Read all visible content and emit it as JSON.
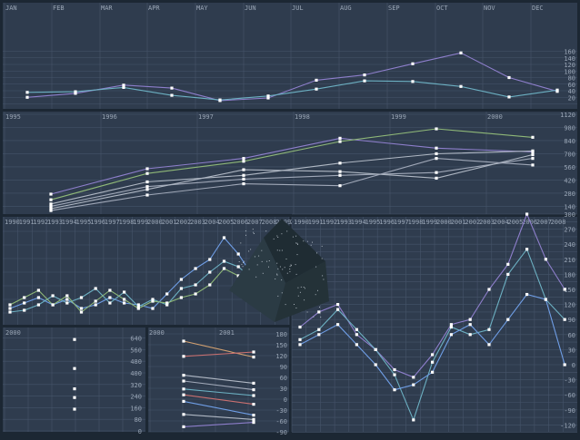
{
  "colors": {
    "background": "#1c2733",
    "panel": "#2f3c4e",
    "grid": "#46546a",
    "text": "#9aa6b6",
    "marker": "#ffffff",
    "purple": "#8e7fcc",
    "teal": "#6cb0c2",
    "blue": "#6f9ee6",
    "green": "#8fb878",
    "gray": "#a0a8b8",
    "silver": "#b0b8c4",
    "red": "#c97070",
    "orange": "#d2a070",
    "cube": "#2c3c44"
  },
  "chart_data": [
    {
      "type": "line",
      "x": [
        "JAN",
        "FEB",
        "MAR",
        "APR",
        "MAY",
        "JUN",
        "JUL",
        "AUG",
        "SEP",
        "OCT",
        "NOV",
        "DEC"
      ],
      "ylim": [
        0,
        170
      ],
      "yticks": [
        "20",
        "40",
        "60",
        "80",
        "100",
        "120",
        "140",
        "160"
      ],
      "series": [
        {
          "color": "purple",
          "values": [
            20,
            32,
            57,
            48,
            10,
            18,
            72,
            88,
            122,
            155,
            80,
            38
          ]
        },
        {
          "color": "teal",
          "values": [
            35,
            37,
            50,
            26,
            12,
            24,
            45,
            70,
            68,
            53,
            21,
            42
          ]
        }
      ],
      "grid": true
    },
    {
      "type": "line",
      "x_labels": [
        "1995",
        "1996",
        "1997",
        "1998",
        "1999",
        "2000"
      ],
      "x": [
        1995.3,
        1996.3,
        1997.3,
        1998.3,
        1999.3,
        2000.3
      ],
      "ylim": [
        70,
        1120
      ],
      "yticks": [
        "140",
        "280",
        "420",
        "560",
        "700",
        "840",
        "980",
        "1120"
      ],
      "series": [
        {
          "color": "purple",
          "values": [
            270,
            540,
            650,
            865,
            760,
            720
          ]
        },
        {
          "color": "green",
          "values": [
            210,
            490,
            620,
            830,
            965,
            875
          ]
        },
        {
          "color": "silver",
          "values": [
            165,
            400,
            470,
            600,
            700,
            730
          ]
        },
        {
          "color": "gray",
          "values": [
            140,
            350,
            430,
            470,
            500,
            650
          ]
        },
        {
          "color": "silver",
          "values": [
            115,
            320,
            530,
            510,
            440,
            690
          ]
        },
        {
          "color": "gray",
          "values": [
            95,
            260,
            380,
            360,
            650,
            580
          ]
        }
      ],
      "grid": true
    },
    {
      "type": "line",
      "x_labels": [
        "1990",
        "1991",
        "1992",
        "1993",
        "1994",
        "1995",
        "1996",
        "1997",
        "1998",
        "1999",
        "2000",
        "2001",
        "2002",
        "2003",
        "2004",
        "2005",
        "2006",
        "2007",
        "2008",
        "2009",
        "2010"
      ],
      "ylim": [
        0,
        300
      ],
      "series": [
        {
          "color": "blue",
          "values": [
            30,
            45,
            60,
            40,
            55,
            30,
            40,
            60,
            45,
            40,
            30,
            70,
            110,
            140,
            165,
            225,
            180,
            120
          ]
        },
        {
          "color": "teal",
          "values": [
            20,
            25,
            40,
            65,
            45,
            60,
            85,
            45,
            75,
            35,
            55,
            40,
            85,
            95,
            130,
            160,
            145,
            110
          ]
        },
        {
          "color": "green",
          "values": [
            40,
            60,
            80,
            40,
            65,
            20,
            50,
            80,
            55,
            30,
            50,
            45,
            60,
            70,
            95,
            140,
            120,
            95
          ]
        }
      ],
      "grid": true
    },
    {
      "type": "line",
      "ylim": [
        -140,
        320
      ],
      "yticks": [
        "-120",
        "-90",
        "-60",
        "-30",
        "0",
        "30",
        "60",
        "90",
        "120",
        "150",
        "180",
        "210",
        "240",
        "270",
        "300"
      ],
      "series": [
        {
          "color": "purple",
          "values": [
            75,
            105,
            120,
            60,
            30,
            -10,
            -25,
            20,
            80,
            90,
            150,
            200,
            300,
            210,
            150
          ]
        },
        {
          "color": "teal",
          "values": [
            50,
            70,
            110,
            70,
            30,
            -20,
            -110,
            5,
            75,
            60,
            70,
            180,
            230,
            130,
            90
          ]
        },
        {
          "color": "blue",
          "values": [
            40,
            60,
            80,
            40,
            0,
            -50,
            -40,
            -15,
            60,
            80,
            40,
            90,
            140,
            130,
            0
          ]
        }
      ],
      "grid": true
    },
    {
      "type": "scatter",
      "x_labels": [
        "2000"
      ],
      "ylim": [
        0,
        700
      ],
      "yticks": [
        "0",
        "80",
        "160",
        "240",
        "320",
        "400",
        "480",
        "560",
        "640"
      ],
      "values": [
        630,
        430,
        290,
        230,
        150
      ],
      "grid": true
    },
    {
      "type": "line",
      "x_labels": [
        "2000",
        "2001"
      ],
      "ylim": [
        -100,
        200
      ],
      "yticks": [
        "-90",
        "-60",
        "-30",
        "0",
        "30",
        "60",
        "90",
        "120",
        "150",
        "180"
      ],
      "series": [
        {
          "color": "orange",
          "values": [
            160,
            116
          ]
        },
        {
          "color": "red",
          "values": [
            118,
            130
          ]
        },
        {
          "color": "silver",
          "values": [
            66,
            44
          ]
        },
        {
          "color": "gray",
          "values": [
            50,
            26
          ]
        },
        {
          "color": "teal",
          "values": [
            28,
            10
          ]
        },
        {
          "color": "red",
          "values": [
            12,
            -14
          ]
        },
        {
          "color": "blue",
          "values": [
            -6,
            -44
          ]
        },
        {
          "color": "silver",
          "values": [
            -42,
            -56
          ]
        },
        {
          "color": "purple",
          "values": [
            -76,
            -64
          ]
        }
      ],
      "grid": true
    }
  ]
}
